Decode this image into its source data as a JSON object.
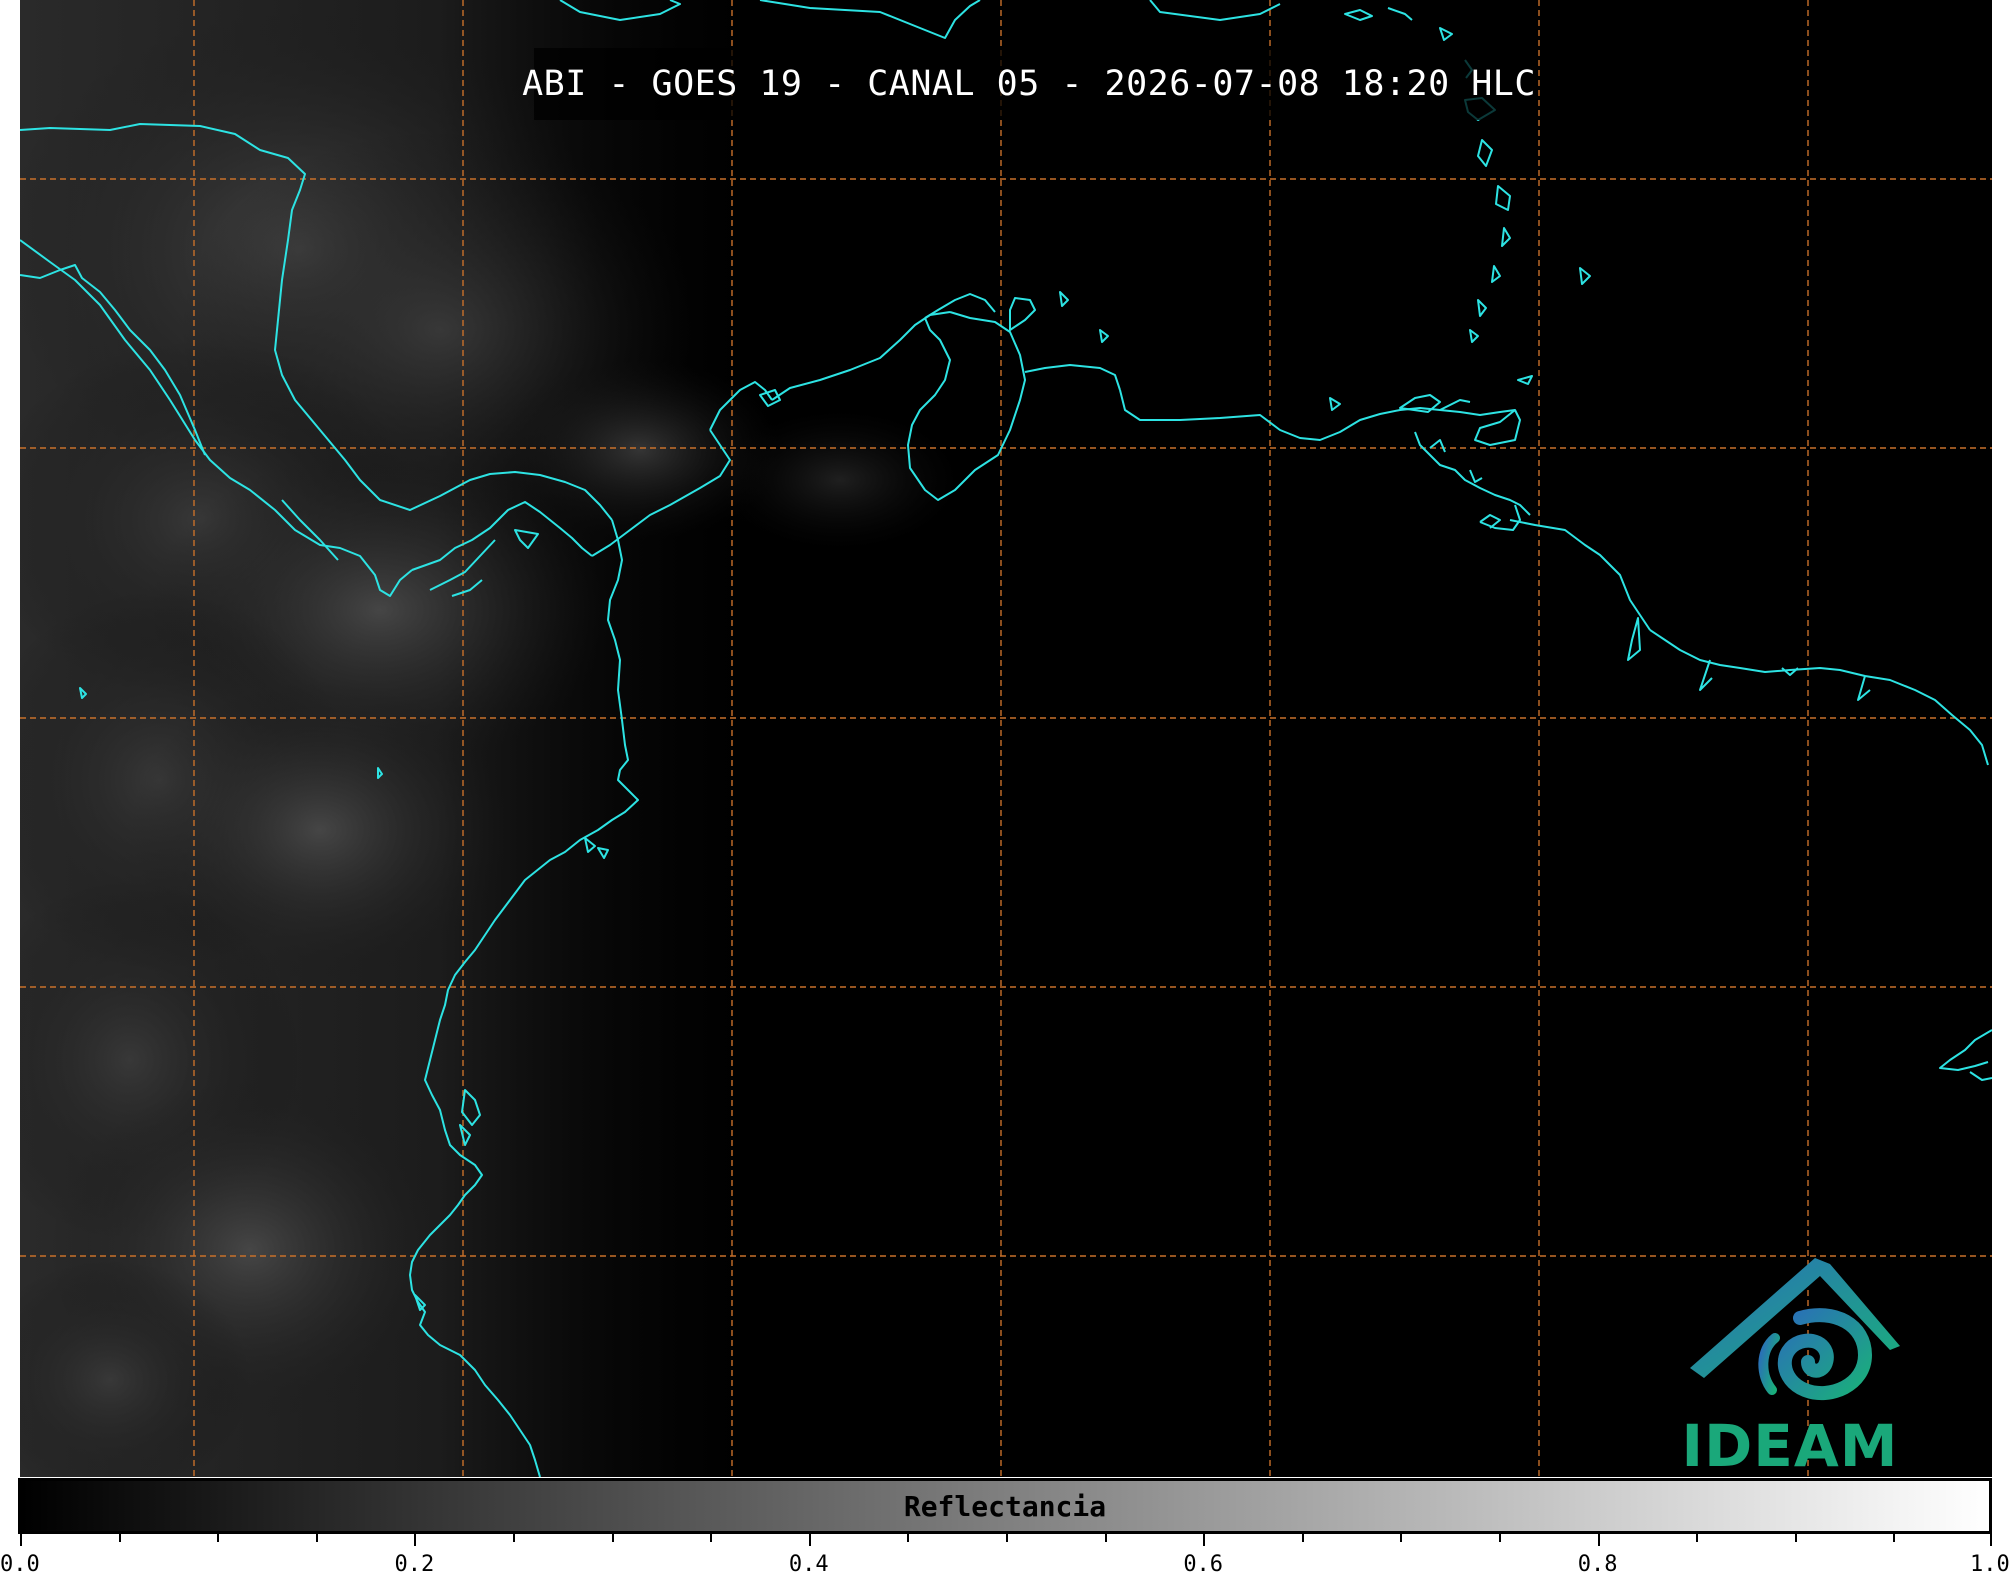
{
  "title": "ABI - GOES 19 - CANAL 05 - 2026-07-08 18:20 HLC",
  "colorbar": {
    "label": "Reflectancia",
    "min": 0.0,
    "max": 1.0,
    "tick_labels": [
      "0.0",
      "0.2",
      "0.4",
      "0.6",
      "0.8",
      "1.0"
    ],
    "colormap": [
      "#000000",
      "#ffffff"
    ]
  },
  "logo": {
    "text": "IDEAM",
    "color": "#1aa87a",
    "icon": "ideam-mountain-swirl-icon"
  },
  "map": {
    "background_color": "#000000",
    "coastline_color": "#2de3e3",
    "gridline_color": "#c8702a",
    "gridline_style": "dashed"
  }
}
